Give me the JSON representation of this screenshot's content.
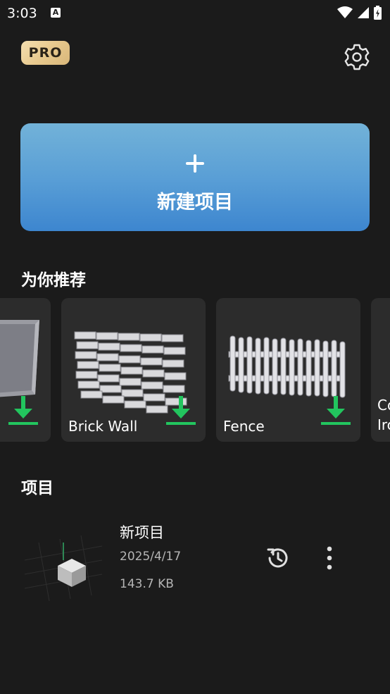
{
  "status_bar": {
    "time": "3:03",
    "notification_icon": "a-icon"
  },
  "header": {
    "pro_badge": "PRO",
    "settings_icon": "gear-icon"
  },
  "new_project": {
    "label": "新建项目",
    "icon": "plus-icon",
    "colors": {
      "top": "#72b2d8",
      "bottom": "#3d86cf"
    }
  },
  "recommended": {
    "title": "为你推荐",
    "items": [
      {
        "label": ""
      },
      {
        "label": "Brick Wall"
      },
      {
        "label": "Fence"
      },
      {
        "label": "Co\nIrc"
      }
    ],
    "download_color": "#22c55e"
  },
  "projects": {
    "title": "项目",
    "items": [
      {
        "name": "新项目",
        "date": "2025/4/17",
        "size": "143.7 KB"
      }
    ]
  }
}
